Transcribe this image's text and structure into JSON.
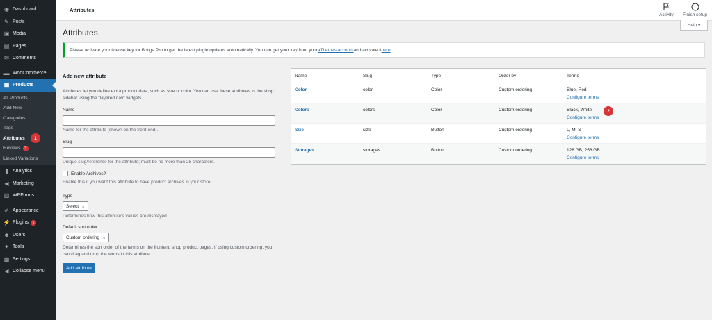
{
  "sidebar": {
    "top_items": [
      {
        "icon": "dashboard-icon",
        "glyph": "◉",
        "label": "Dashboard"
      },
      {
        "icon": "pin-icon",
        "glyph": "✎",
        "label": "Posts"
      },
      {
        "icon": "media-icon",
        "glyph": "▣",
        "label": "Media"
      },
      {
        "icon": "pages-icon",
        "glyph": "▤",
        "label": "Pages"
      },
      {
        "icon": "comment-icon",
        "glyph": "✉",
        "label": "Comments"
      }
    ],
    "woocommerce": {
      "icon": "woocommerce-icon",
      "glyph": "▬",
      "label": "WooCommerce"
    },
    "products": {
      "icon": "products-icon",
      "glyph": "▦",
      "label": "Products"
    },
    "submenu": [
      {
        "label": "All Products"
      },
      {
        "label": "Add New"
      },
      {
        "label": "Categories"
      },
      {
        "label": "Tags"
      },
      {
        "label": "Attributes",
        "current": true
      },
      {
        "label": "Reviews",
        "badge": "3"
      },
      {
        "label": "Linked Variations"
      }
    ],
    "bottom_items": [
      {
        "icon": "analytics-icon",
        "glyph": "▮",
        "label": "Analytics"
      },
      {
        "icon": "megaphone-icon",
        "glyph": "◀",
        "label": "Marketing"
      },
      {
        "icon": "wpforms-icon",
        "glyph": "▥",
        "label": "WPForms"
      }
    ],
    "admin_items": [
      {
        "icon": "brush-icon",
        "glyph": "✐",
        "label": "Appearance"
      },
      {
        "icon": "plugin-icon",
        "glyph": "⚡",
        "label": "Plugins",
        "badge": "1"
      },
      {
        "icon": "users-icon",
        "glyph": "☻",
        "label": "Users"
      },
      {
        "icon": "wrench-icon",
        "glyph": "✦",
        "label": "Tools"
      },
      {
        "icon": "settings-icon",
        "glyph": "▩",
        "label": "Settings"
      },
      {
        "icon": "collapse-icon",
        "glyph": "◀",
        "label": "Collapse menu"
      }
    ]
  },
  "topbar": {
    "title": "Attributes",
    "activity_label": "Activity",
    "finish_label": "Finish setup"
  },
  "help_label": "Help ▾",
  "page_title": "Attributes",
  "notice": {
    "text_before": "Please activate your license key for Botiga Pro to get the latest plugin updates automatically. You can get your key from your ",
    "link1": "aThemes account",
    "text_middle": " and activate it ",
    "link2": "here"
  },
  "form": {
    "heading": "Add new attribute",
    "intro": "Attributes let you define extra product data, such as size or color. You can use these attributes in the shop sidebar using the \"layered nav\" widgets.",
    "name_label": "Name",
    "name_hint": "Name for the attribute (shown on the front-end).",
    "slug_label": "Slug",
    "slug_hint": "Unique slug/reference for the attribute; must be no more than 28 characters.",
    "archives_label": "Enable Archives?",
    "archives_hint": "Enable this if you want this attribute to have product archives in your store.",
    "type_label": "Type",
    "type_value": "Select",
    "type_hint": "Determines how this attribute's values are displayed.",
    "sort_label": "Default sort order",
    "sort_value": "Custom ordering",
    "sort_hint": "Determines the sort order of the terms on the frontend shop product pages. If using custom ordering, you can drag and drop the terms in this attribute.",
    "submit_label": "Add attribute"
  },
  "table": {
    "headers": [
      "Name",
      "Slug",
      "Type",
      "Order by",
      "Terms"
    ],
    "rows": [
      {
        "name": "Color",
        "slug": "color",
        "type": "Color",
        "order": "Custom ordering",
        "terms": "Blue, Red",
        "configure": "Configure terms"
      },
      {
        "name": "Colors",
        "slug": "colors",
        "type": "Color",
        "order": "Custom ordering",
        "terms": "Black, White",
        "configure": "Configure terms"
      },
      {
        "name": "Size",
        "slug": "size",
        "type": "Button",
        "order": "Custom ordering",
        "terms": "L, M, S",
        "configure": "Configure terms"
      },
      {
        "name": "Storages",
        "slug": "storages",
        "type": "Button",
        "order": "Custom ordering",
        "terms": "128 GB, 256 GB",
        "configure": "Configure terms"
      }
    ]
  },
  "markers": {
    "m1": "1",
    "m2": "2"
  },
  "colors": {
    "accent": "#2271b1",
    "sidebar": "#1d2327",
    "marker": "#d63638",
    "notice_border": "#00a32a"
  }
}
